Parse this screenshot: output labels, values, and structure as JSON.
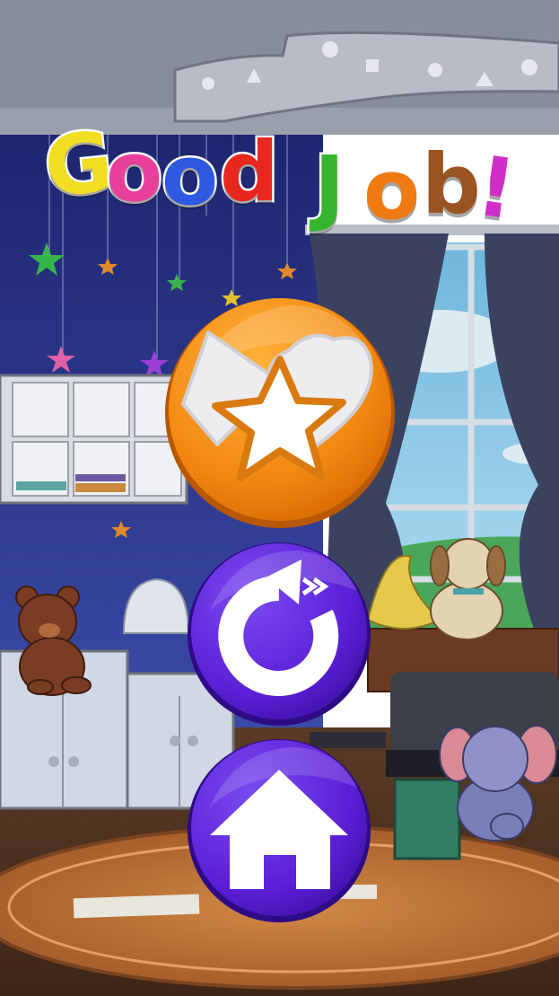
{
  "screen": "level-complete",
  "title": {
    "letters": [
      {
        "char": "G",
        "color": "#f2dd22"
      },
      {
        "char": "o",
        "color": "#e73f9a"
      },
      {
        "char": "o",
        "color": "#2d59e3"
      },
      {
        "char": "d",
        "color": "#e8281f"
      },
      {
        "char": "J",
        "color": "#36b52e"
      },
      {
        "char": "o",
        "color": "#f07a12"
      },
      {
        "char": "b",
        "color": "#9a5421"
      },
      {
        "char": "!",
        "color": "#d02ec8"
      }
    ]
  },
  "buttons": {
    "shapes": {
      "icon": "shapes-icon",
      "color": "#f18a10"
    },
    "replay": {
      "icon": "replay-icon",
      "color": "#5a1fd6"
    },
    "home": {
      "icon": "home-icon",
      "color": "#5a1fd6"
    }
  },
  "colors": {
    "wall": "#2e3b8f",
    "ceiling": "#8a909c",
    "floor": "#6a4128",
    "rug": "#c47a3b",
    "sky": "#7fc4e3"
  }
}
